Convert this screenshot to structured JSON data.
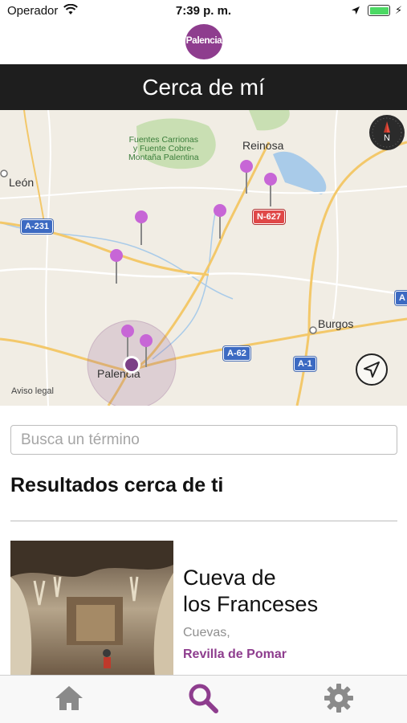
{
  "status_bar": {
    "carrier": "Operador",
    "time": "7:39 p. m.",
    "wifi_icon": "wifi-icon",
    "location_icon": "location-arrow-icon",
    "battery_icon": "battery-icon",
    "battery_color": "#4cd964"
  },
  "header": {
    "logo_text": "Palencia",
    "logo_color": "#8e3d8e",
    "title": "Cerca de mí"
  },
  "map": {
    "labels": {
      "natural_park_1": "Fuentes Carrionas",
      "natural_park_2": "y Fuente Cobre-",
      "natural_park_3": "Montaña Palentina",
      "reinosa": "Reinosa",
      "leon": "León",
      "burgos": "Burgos",
      "palencia": "Palencia",
      "road_a231": "A-231",
      "road_n627": "N-627",
      "road_a62": "A-62",
      "road_a1": "A-1",
      "road_a_edge": "A",
      "legal": "Aviso legal"
    },
    "compass_icon": "compass-icon",
    "locate_icon": "locate-me-icon",
    "pin_color": "#c766d6"
  },
  "search": {
    "placeholder": "Busca un término",
    "value": ""
  },
  "results": {
    "title": "Resultados cerca de ti",
    "items": [
      {
        "name_line1": "Cueva de",
        "name_line2": "los Franceses",
        "category": "Cuevas,",
        "town": "Revilla de Pomar"
      }
    ]
  },
  "tabbar": {
    "active_color": "#8e3d8e",
    "inactive_color": "#8a8a8a",
    "tabs": [
      "home-icon",
      "search-icon",
      "settings-gear-icon"
    ]
  }
}
